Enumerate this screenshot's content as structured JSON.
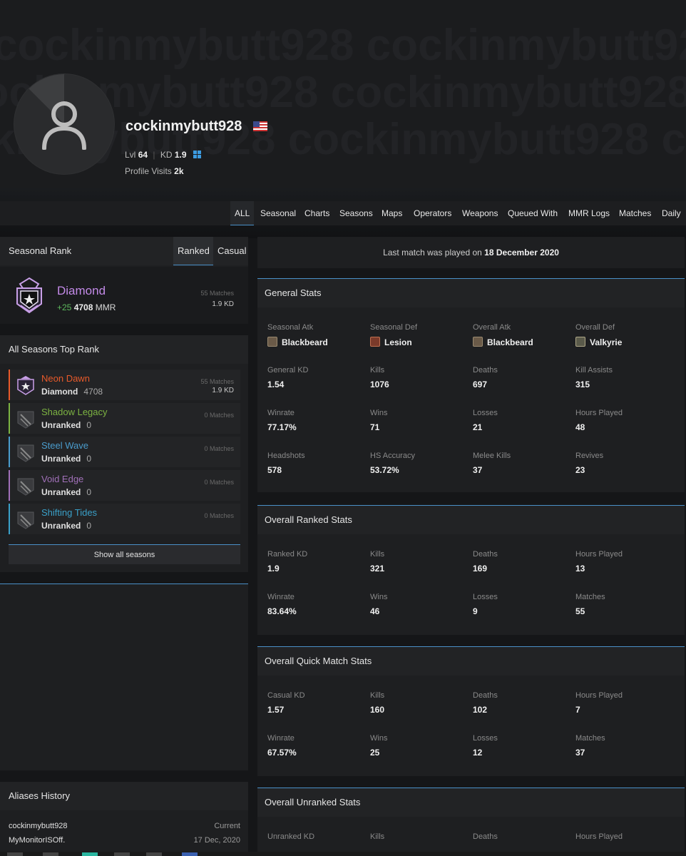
{
  "profile": {
    "username": "cockinmybutt928",
    "watermark": "cockinmybutt928 cockinmybutt928 cockinmybutt928",
    "level_label": "Lvl",
    "level": "64",
    "kd_label": "KD",
    "kd": "1.9",
    "visits_label": "Profile Visits",
    "visits": "2k"
  },
  "tabs": [
    "ALL",
    "Seasonal",
    "Charts",
    "Seasons",
    "Maps",
    "Operators",
    "Weapons",
    "Queued With",
    "MMR Logs",
    "Matches",
    "Daily"
  ],
  "seasonal_rank": {
    "title": "Seasonal Rank",
    "toggle_ranked": "Ranked",
    "toggle_casual": "Casual",
    "rank": "Diamond",
    "mmr_change": "+25",
    "mmr": "4708",
    "mmr_label": "MMR",
    "matches": "55 Matches",
    "kd": "1.9 KD"
  },
  "all_seasons": {
    "title": "All Seasons Top Rank",
    "items": [
      {
        "season": "Neon Dawn",
        "rank": "Diamond",
        "mmr": "4708",
        "matches": "55 Matches",
        "kd": "1.9 KD",
        "color": "#e85a2a"
      },
      {
        "season": "Shadow Legacy",
        "rank": "Unranked",
        "mmr": "0",
        "matches": "0 Matches",
        "kd": "",
        "color": "#7cb342"
      },
      {
        "season": "Steel Wave",
        "rank": "Unranked",
        "mmr": "0",
        "matches": "0 Matches",
        "kd": "",
        "color": "#4a9ccc"
      },
      {
        "season": "Void Edge",
        "rank": "Unranked",
        "mmr": "0",
        "matches": "0 Matches",
        "kd": "",
        "color": "#a070b8"
      },
      {
        "season": "Shifting Tides",
        "rank": "Unranked",
        "mmr": "0",
        "matches": "0 Matches",
        "kd": "",
        "color": "#3aa0c8"
      }
    ],
    "show_all": "Show all seasons"
  },
  "last_match": {
    "prefix": "Last match was played on",
    "date": "18 December 2020"
  },
  "general_stats": {
    "title": "General Stats",
    "cells": [
      {
        "label": "Seasonal Atk",
        "value": "Blackbeard",
        "op": true
      },
      {
        "label": "Seasonal Def",
        "value": "Lesion",
        "op": true
      },
      {
        "label": "Overall Atk",
        "value": "Blackbeard",
        "op": true
      },
      {
        "label": "Overall Def",
        "value": "Valkyrie",
        "op": true
      },
      {
        "label": "General KD",
        "value": "1.54"
      },
      {
        "label": "Kills",
        "value": "1076"
      },
      {
        "label": "Deaths",
        "value": "697"
      },
      {
        "label": "Kill Assists",
        "value": "315"
      },
      {
        "label": "Winrate",
        "value": "77.17%"
      },
      {
        "label": "Wins",
        "value": "71"
      },
      {
        "label": "Losses",
        "value": "21"
      },
      {
        "label": "Hours Played",
        "value": "48"
      },
      {
        "label": "Headshots",
        "value": "578"
      },
      {
        "label": "HS Accuracy",
        "value": "53.72%"
      },
      {
        "label": "Melee Kills",
        "value": "37"
      },
      {
        "label": "Revives",
        "value": "23"
      }
    ]
  },
  "ranked_stats": {
    "title": "Overall Ranked Stats",
    "cells": [
      {
        "label": "Ranked KD",
        "value": "1.9"
      },
      {
        "label": "Kills",
        "value": "321"
      },
      {
        "label": "Deaths",
        "value": "169"
      },
      {
        "label": "Hours Played",
        "value": "13"
      },
      {
        "label": "Winrate",
        "value": "83.64%"
      },
      {
        "label": "Wins",
        "value": "46"
      },
      {
        "label": "Losses",
        "value": "9"
      },
      {
        "label": "Matches",
        "value": "55"
      }
    ]
  },
  "quick_stats": {
    "title": "Overall Quick Match Stats",
    "cells": [
      {
        "label": "Casual KD",
        "value": "1.57"
      },
      {
        "label": "Kills",
        "value": "160"
      },
      {
        "label": "Deaths",
        "value": "102"
      },
      {
        "label": "Hours Played",
        "value": "7"
      },
      {
        "label": "Winrate",
        "value": "67.57%"
      },
      {
        "label": "Wins",
        "value": "25"
      },
      {
        "label": "Losses",
        "value": "12"
      },
      {
        "label": "Matches",
        "value": "37"
      }
    ]
  },
  "unranked_stats": {
    "title": "Overall Unranked Stats",
    "cells": [
      {
        "label": "Unranked KD",
        "value": ""
      },
      {
        "label": "Kills",
        "value": ""
      },
      {
        "label": "Deaths",
        "value": ""
      },
      {
        "label": "Hours Played",
        "value": ""
      }
    ]
  },
  "aliases": {
    "title": "Aliases History",
    "items": [
      {
        "name": "cockinmybutt928",
        "when": "Current"
      },
      {
        "name": "MyMonitorISOff.",
        "when": "17 Dec, 2020"
      }
    ]
  },
  "colors": {
    "accent": "#4a90c8",
    "diamond": "#c38ae8",
    "positive": "#5db85d"
  }
}
